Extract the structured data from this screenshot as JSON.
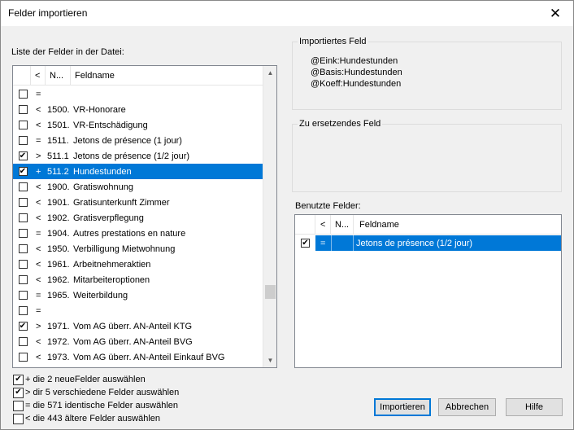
{
  "window": {
    "title": "Felder importieren",
    "close_glyph": "✕"
  },
  "left": {
    "list_label": "Liste der Felder in der Datei:",
    "columns": [
      "<",
      "N...",
      "Feldname"
    ],
    "rows": [
      {
        "checked": false,
        "op": "=",
        "num": "",
        "name": ""
      },
      {
        "checked": false,
        "op": "<",
        "num": "1500.",
        "name": "VR-Honorare"
      },
      {
        "checked": false,
        "op": "<",
        "num": "1501.",
        "name": "VR-Entschädigung"
      },
      {
        "checked": false,
        "op": "=",
        "num": "1511.",
        "name": "Jetons de présence (1 jour)"
      },
      {
        "checked": true,
        "op": ">",
        "num": "511.1",
        "name": "Jetons de présence (1/2 jour)"
      },
      {
        "checked": true,
        "op": "+",
        "num": "511.2",
        "name": "Hundestunden",
        "selected": true
      },
      {
        "checked": false,
        "op": "<",
        "num": "1900.",
        "name": "Gratiswohnung"
      },
      {
        "checked": false,
        "op": "<",
        "num": "1901.",
        "name": "Gratisunterkunft Zimmer"
      },
      {
        "checked": false,
        "op": "<",
        "num": "1902.",
        "name": "Gratisverpflegung"
      },
      {
        "checked": false,
        "op": "=",
        "num": "1904.",
        "name": "Autres prestations en nature"
      },
      {
        "checked": false,
        "op": "<",
        "num": "1950.",
        "name": "Verbilligung Mietwohnung"
      },
      {
        "checked": false,
        "op": "<",
        "num": "1961.",
        "name": "Arbeitnehmeraktien"
      },
      {
        "checked": false,
        "op": "<",
        "num": "1962.",
        "name": "Mitarbeiteroptionen"
      },
      {
        "checked": false,
        "op": "=",
        "num": "1965.",
        "name": "Weiterbildung"
      },
      {
        "checked": false,
        "op": "=",
        "num": "",
        "name": ""
      },
      {
        "checked": true,
        "op": ">",
        "num": "1971.",
        "name": "Vom AG überr. AN-Anteil KTG"
      },
      {
        "checked": false,
        "op": "<",
        "num": "1972.",
        "name": "Vom AG überr. AN-Anteil BVG"
      },
      {
        "checked": false,
        "op": "<",
        "num": "1973.",
        "name": "Vom AG überr. AN-Anteil Einkauf BVG"
      }
    ]
  },
  "imported": {
    "caption": "Importiertes Feld",
    "lines": [
      "@Eink:Hundestunden",
      "@Basis:Hundestunden",
      "@Koeff:Hundestunden"
    ]
  },
  "replace": {
    "caption": "Zu ersetzendes Feld"
  },
  "used": {
    "label": "Benutzte Felder:",
    "columns": [
      "<",
      "N...",
      "Feldname"
    ],
    "rows": [
      {
        "checked": true,
        "op": "=",
        "num": "",
        "name": "Jetons de présence (1/2 jour)",
        "selected": true
      }
    ]
  },
  "options": [
    {
      "checked": true,
      "label": "+ die 2 neueFelder auswählen"
    },
    {
      "checked": true,
      "label": "> dir 5 verschiedene Felder auswählen"
    },
    {
      "checked": false,
      "label": "= die 571 identische Felder auswählen"
    },
    {
      "checked": false,
      "label": "< die 443 ältere Felder auswählen"
    }
  ],
  "buttons": {
    "import": "Importieren",
    "cancel": "Abbrechen",
    "help": "Hilfe"
  },
  "scroll": {
    "position_fraction": 0.79
  }
}
